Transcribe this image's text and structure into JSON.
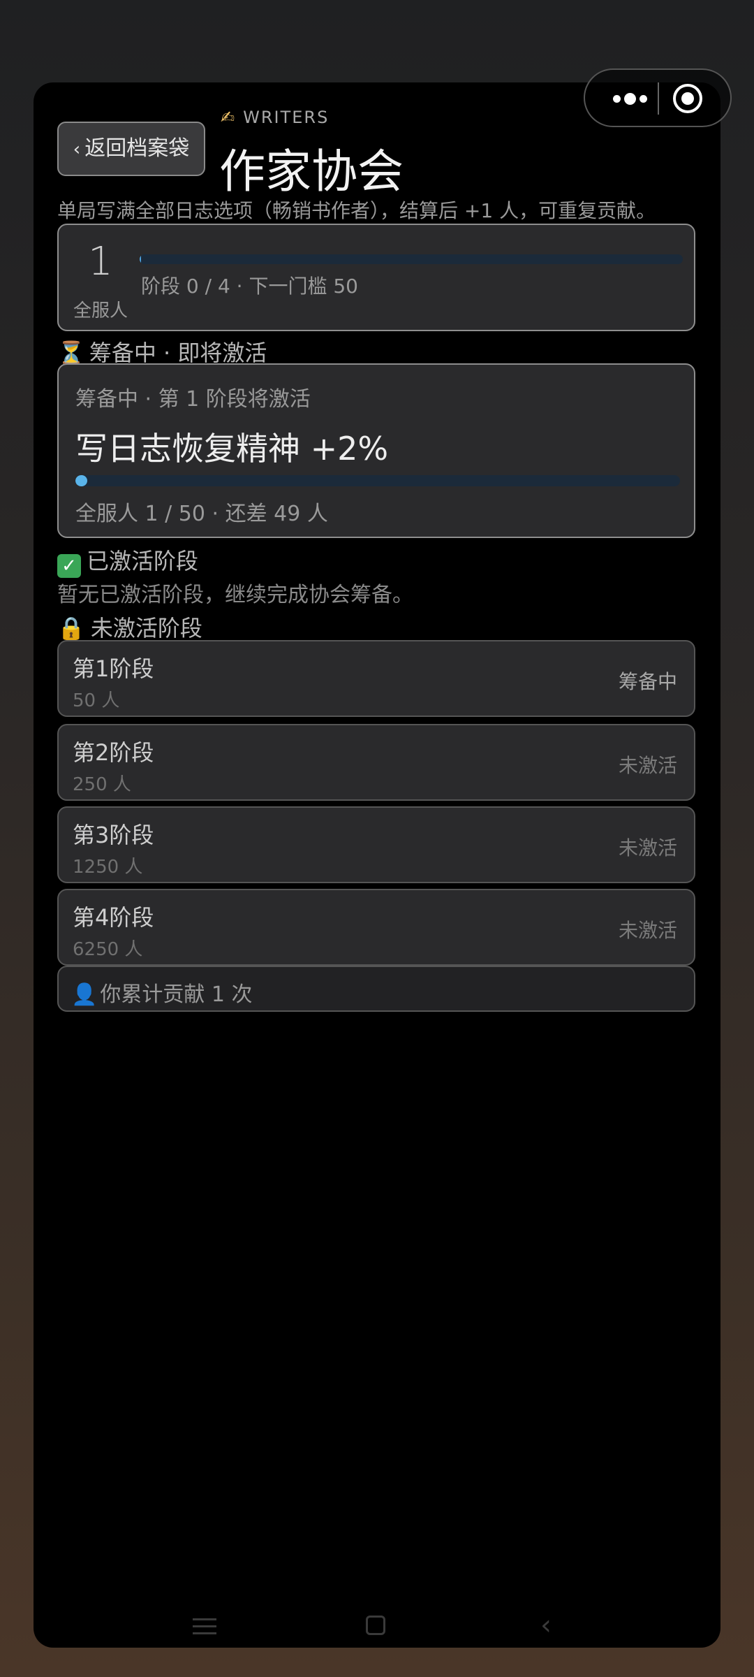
{
  "header": {
    "back_label": "返回档案袋",
    "kicker": "WRITERS",
    "title": "作家协会",
    "description": "单局写满全部日志选项（畅销书作者），结算后 +1 人，可重复贡献。"
  },
  "summary": {
    "total": "1",
    "total_label": "全服人",
    "progress": 0.02,
    "meta": "阶段 0 / 4 · 下一门槛 50"
  },
  "preparing": {
    "section_title": "筹备中 · 即将激活",
    "label": "筹备中 · 第 1 阶段将激活",
    "effect": "写日志恢复精神 +2%",
    "progress": 0.02,
    "stat": "全服人 1 / 50 · 还差 49 人"
  },
  "activated": {
    "section_title": "已激活阶段",
    "empty_note": "暂无已激活阶段，继续完成协会筹备。"
  },
  "inactive": {
    "section_title": "未激活阶段",
    "tiers": [
      {
        "name": "第1阶段",
        "count": "50 人",
        "status": "筹备中"
      },
      {
        "name": "第2阶段",
        "count": "250 人",
        "status": "未激活"
      },
      {
        "name": "第3阶段",
        "count": "1250 人",
        "status": "未激活"
      },
      {
        "name": "第4阶段",
        "count": "6250 人",
        "status": "未激活"
      }
    ]
  },
  "contribution": "你累计贡献 1 次",
  "icons": {
    "pen": "writing-hand-icon",
    "hourglass": "hourglass-icon",
    "check": "check-mark-icon",
    "lock": "lock-icon",
    "user": "user-icon"
  },
  "colors": {
    "accent_blue": "#5ab4ea",
    "track": "#1b2a3a",
    "check_green": "#3aa657",
    "lock_orange": "#f0a732"
  }
}
